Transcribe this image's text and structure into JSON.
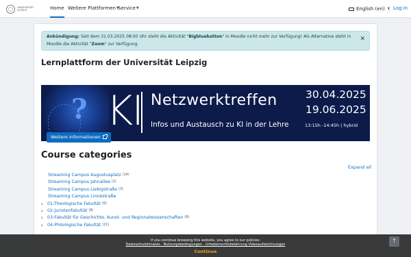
{
  "navbar": {
    "logo_text": "UNIVERSITÄT LEIPZIG",
    "home": "Home",
    "more_platforms": "Weitere Plattformen",
    "service": "Service",
    "language": "English (en)",
    "login": "Log in"
  },
  "alert": {
    "prefix": "Ankündigung:",
    "text1": " Seit dem 31.03.2025 08:00 Uhr steht die Aktivität \"",
    "bold1": "Bigbluebutton",
    "text2": "\" in Moodle nicht mehr zur Verfügung! Als Alternative steht in Moodle die Aktivität \"",
    "bold2": "Zoom",
    "text3": "\" zur Verfügung."
  },
  "page_title": "Lernplattform der Universität Leipzig",
  "banner": {
    "ki": "KI",
    "title": "Netzwerktreffen",
    "subtitle": "Infos und Austausch zu KI in der Lehre",
    "date1": "30.04.2025",
    "date2": "19.06.2025",
    "time": "13:15h -14:45h | hybrid",
    "button": "Weitere Informationen"
  },
  "categories": {
    "title": "Course categories",
    "expand_all": "Expand all",
    "items": [
      {
        "name": "Streaming Campus Augustusplatz",
        "count": "(14)",
        "expandable": false
      },
      {
        "name": "Streaming Campus Jahnallee",
        "count": "(2)",
        "expandable": false
      },
      {
        "name": "Streaming Campus Liebigstraße",
        "count": "(3)",
        "expandable": false
      },
      {
        "name": "Streaming Campus Linnéstraße",
        "count": "",
        "expandable": false
      },
      {
        "name": "01-Theologische Fakultät",
        "count": "(6)",
        "expandable": true
      },
      {
        "name": "02-Juristenfakultät",
        "count": "(8)",
        "expandable": true
      },
      {
        "name": "03-Fakultät für Geschichte, Kunst- und Regionalwissenschaften",
        "count": "(9)",
        "expandable": true
      },
      {
        "name": "04-Philologische Fakultät",
        "count": "(21)",
        "expandable": true
      }
    ]
  },
  "cookie": {
    "text": "If you continue browsing this website, you agree to our policies:",
    "links": "Datenschutzhinweis · Nutzungsbedingungen · Urheberrechtsbelehrung Videoaufzeichnungen",
    "button": "Continue"
  }
}
